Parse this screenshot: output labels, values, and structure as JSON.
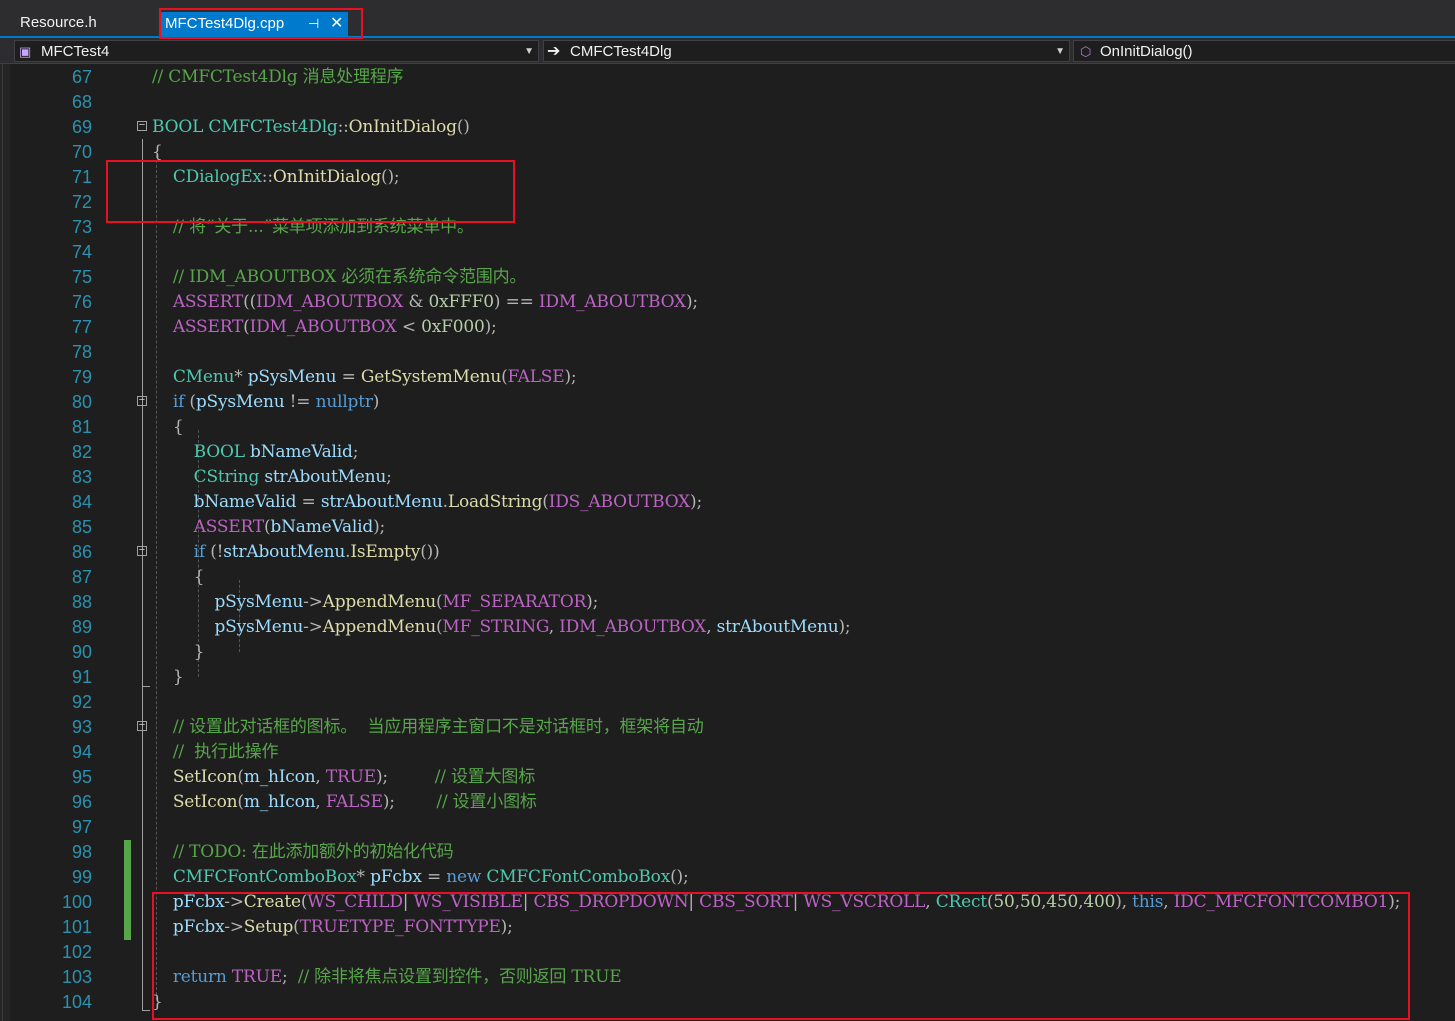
{
  "tabs": {
    "inactive": "Resource.h",
    "active": "MFCTest4Dlg.cpp",
    "pin_glyph": "⊣",
    "close_glyph": "✕"
  },
  "nav": {
    "project": "MFCTest4",
    "class": "CMFCTest4Dlg",
    "member": "OnInitDialog()"
  },
  "colors": {
    "keyword": "#569cd6",
    "type": "#4ec9b0",
    "function": "#dcdcaa",
    "macro": "#bd63c5",
    "comment": "#57a64a",
    "line_number": "#2b91af",
    "annotation_box": "#e81123",
    "active_tab": "#007acc"
  },
  "code_lines": [
    {
      "n": "67",
      "parts": [
        [
          "cm",
          "// CMFCTest4Dlg 消息处理程序"
        ]
      ]
    },
    {
      "n": "68",
      "parts": []
    },
    {
      "n": "69",
      "parts": [
        [
          "ty",
          "BOOL"
        ],
        [
          "pl",
          " "
        ],
        [
          "ty",
          "CMFCTest4Dlg"
        ],
        [
          "pu",
          "::"
        ],
        [
          "fn",
          "OnInitDialog"
        ],
        [
          "pu",
          "()"
        ]
      ]
    },
    {
      "n": "70",
      "parts": [
        [
          "pu",
          "{"
        ]
      ]
    },
    {
      "n": "71",
      "parts": [
        [
          "pl",
          "    "
        ],
        [
          "ty",
          "CDialogEx"
        ],
        [
          "pu",
          "::"
        ],
        [
          "fn",
          "OnInitDialog"
        ],
        [
          "pu",
          "();"
        ]
      ]
    },
    {
      "n": "72",
      "parts": []
    },
    {
      "n": "73",
      "parts": [
        [
          "pl",
          "    "
        ],
        [
          "cm",
          "// 将“关于...”菜单项添加到系统菜单中。"
        ]
      ]
    },
    {
      "n": "74",
      "parts": []
    },
    {
      "n": "75",
      "parts": [
        [
          "pl",
          "    "
        ],
        [
          "cm",
          "// IDM_ABOUTBOX 必须在系统命令范围内。"
        ]
      ]
    },
    {
      "n": "76",
      "parts": [
        [
          "pl",
          "    "
        ],
        [
          "mc",
          "ASSERT"
        ],
        [
          "pu",
          "(("
        ],
        [
          "mc",
          "IDM_ABOUTBOX"
        ],
        [
          "pl",
          " "
        ],
        [
          "pu",
          "&"
        ],
        [
          "pl",
          " "
        ],
        [
          "nu",
          "0xFFF0"
        ],
        [
          "pu",
          ")"
        ],
        [
          "pl",
          " "
        ],
        [
          "pu",
          "=="
        ],
        [
          "pl",
          " "
        ],
        [
          "mc",
          "IDM_ABOUTBOX"
        ],
        [
          "pu",
          ");"
        ]
      ]
    },
    {
      "n": "77",
      "parts": [
        [
          "pl",
          "    "
        ],
        [
          "mc",
          "ASSERT"
        ],
        [
          "pu",
          "("
        ],
        [
          "mc",
          "IDM_ABOUTBOX"
        ],
        [
          "pl",
          " "
        ],
        [
          "pu",
          "<"
        ],
        [
          "pl",
          " "
        ],
        [
          "nu",
          "0xF000"
        ],
        [
          "pu",
          ");"
        ]
      ]
    },
    {
      "n": "78",
      "parts": []
    },
    {
      "n": "79",
      "parts": [
        [
          "pl",
          "    "
        ],
        [
          "ty",
          "CMenu"
        ],
        [
          "pu",
          "*"
        ],
        [
          "pl",
          " "
        ],
        [
          "va",
          "pSysMenu"
        ],
        [
          "pl",
          " "
        ],
        [
          "pu",
          "="
        ],
        [
          "pl",
          " "
        ],
        [
          "fn",
          "GetSystemMenu"
        ],
        [
          "pu",
          "("
        ],
        [
          "mc",
          "FALSE"
        ],
        [
          "pu",
          ");"
        ]
      ]
    },
    {
      "n": "80",
      "parts": [
        [
          "pl",
          "    "
        ],
        [
          "kw",
          "if"
        ],
        [
          "pl",
          " "
        ],
        [
          "pu",
          "("
        ],
        [
          "va",
          "pSysMenu"
        ],
        [
          "pl",
          " "
        ],
        [
          "pu",
          "!="
        ],
        [
          "pl",
          " "
        ],
        [
          "kw",
          "nullptr"
        ],
        [
          "pu",
          ")"
        ]
      ]
    },
    {
      "n": "81",
      "parts": [
        [
          "pl",
          "    "
        ],
        [
          "pu",
          "{"
        ]
      ]
    },
    {
      "n": "82",
      "parts": [
        [
          "pl",
          "        "
        ],
        [
          "ty",
          "BOOL"
        ],
        [
          "pl",
          " "
        ],
        [
          "va",
          "bNameValid"
        ],
        [
          "pu",
          ";"
        ]
      ]
    },
    {
      "n": "83",
      "parts": [
        [
          "pl",
          "        "
        ],
        [
          "ty",
          "CString"
        ],
        [
          "pl",
          " "
        ],
        [
          "va",
          "strAboutMenu"
        ],
        [
          "pu",
          ";"
        ]
      ]
    },
    {
      "n": "84",
      "parts": [
        [
          "pl",
          "        "
        ],
        [
          "va",
          "bNameValid"
        ],
        [
          "pl",
          " "
        ],
        [
          "pu",
          "="
        ],
        [
          "pl",
          " "
        ],
        [
          "va",
          "strAboutMenu"
        ],
        [
          "pu",
          "."
        ],
        [
          "fn",
          "LoadString"
        ],
        [
          "pu",
          "("
        ],
        [
          "mc",
          "IDS_ABOUTBOX"
        ],
        [
          "pu",
          ");"
        ]
      ]
    },
    {
      "n": "85",
      "parts": [
        [
          "pl",
          "        "
        ],
        [
          "mc",
          "ASSERT"
        ],
        [
          "pu",
          "("
        ],
        [
          "va",
          "bNameValid"
        ],
        [
          "pu",
          ");"
        ]
      ]
    },
    {
      "n": "86",
      "parts": [
        [
          "pl",
          "        "
        ],
        [
          "kw",
          "if"
        ],
        [
          "pl",
          " "
        ],
        [
          "pu",
          "(!"
        ],
        [
          "va",
          "strAboutMenu"
        ],
        [
          "pu",
          "."
        ],
        [
          "fn",
          "IsEmpty"
        ],
        [
          "pu",
          "())"
        ]
      ]
    },
    {
      "n": "87",
      "parts": [
        [
          "pl",
          "        "
        ],
        [
          "pu",
          "{"
        ]
      ]
    },
    {
      "n": "88",
      "parts": [
        [
          "pl",
          "            "
        ],
        [
          "va",
          "pSysMenu"
        ],
        [
          "pu",
          "->"
        ],
        [
          "fn",
          "AppendMenu"
        ],
        [
          "pu",
          "("
        ],
        [
          "mc",
          "MF_SEPARATOR"
        ],
        [
          "pu",
          ");"
        ]
      ]
    },
    {
      "n": "89",
      "parts": [
        [
          "pl",
          "            "
        ],
        [
          "va",
          "pSysMenu"
        ],
        [
          "pu",
          "->"
        ],
        [
          "fn",
          "AppendMenu"
        ],
        [
          "pu",
          "("
        ],
        [
          "mc",
          "MF_STRING"
        ],
        [
          "pu",
          ","
        ],
        [
          "pl",
          " "
        ],
        [
          "mc",
          "IDM_ABOUTBOX"
        ],
        [
          "pu",
          ","
        ],
        [
          "pl",
          " "
        ],
        [
          "va",
          "strAboutMenu"
        ],
        [
          "pu",
          ");"
        ]
      ]
    },
    {
      "n": "90",
      "parts": [
        [
          "pl",
          "        "
        ],
        [
          "pu",
          "}"
        ]
      ]
    },
    {
      "n": "91",
      "parts": [
        [
          "pl",
          "    "
        ],
        [
          "pu",
          "}"
        ]
      ]
    },
    {
      "n": "92",
      "parts": []
    },
    {
      "n": "93",
      "parts": [
        [
          "pl",
          "    "
        ],
        [
          "cm",
          "// 设置此对话框的图标。  当应用程序主窗口不是对话框时，框架将自动"
        ]
      ]
    },
    {
      "n": "94",
      "parts": [
        [
          "pl",
          "    "
        ],
        [
          "cm",
          "//  执行此操作"
        ]
      ]
    },
    {
      "n": "95",
      "parts": [
        [
          "pl",
          "    "
        ],
        [
          "fn",
          "SetIcon"
        ],
        [
          "pu",
          "("
        ],
        [
          "va",
          "m_hIcon"
        ],
        [
          "pu",
          ","
        ],
        [
          "pl",
          " "
        ],
        [
          "mc",
          "TRUE"
        ],
        [
          "pu",
          ");"
        ],
        [
          "pl",
          "         "
        ],
        [
          "cm",
          "// 设置大图标"
        ]
      ]
    },
    {
      "n": "96",
      "parts": [
        [
          "pl",
          "    "
        ],
        [
          "fn",
          "SetIcon"
        ],
        [
          "pu",
          "("
        ],
        [
          "va",
          "m_hIcon"
        ],
        [
          "pu",
          ","
        ],
        [
          "pl",
          " "
        ],
        [
          "mc",
          "FALSE"
        ],
        [
          "pu",
          ");"
        ],
        [
          "pl",
          "        "
        ],
        [
          "cm",
          "// 设置小图标"
        ]
      ]
    },
    {
      "n": "97",
      "parts": []
    },
    {
      "n": "98",
      "parts": [
        [
          "pl",
          "    "
        ],
        [
          "cm",
          "// TODO: 在此添加额外的初始化代码"
        ]
      ]
    },
    {
      "n": "99",
      "parts": [
        [
          "pl",
          "    "
        ],
        [
          "ty",
          "CMFCFontComboBox"
        ],
        [
          "pu",
          "*"
        ],
        [
          "pl",
          " "
        ],
        [
          "va",
          "pFcbx"
        ],
        [
          "pl",
          " "
        ],
        [
          "pu",
          "="
        ],
        [
          "pl",
          " "
        ],
        [
          "kw",
          "new"
        ],
        [
          "pl",
          " "
        ],
        [
          "ty",
          "CMFCFontComboBox"
        ],
        [
          "pu",
          "();"
        ]
      ]
    },
    {
      "n": "100",
      "parts": [
        [
          "pl",
          "    "
        ],
        [
          "va",
          "pFcbx"
        ],
        [
          "pu",
          "->"
        ],
        [
          "fn",
          "Create"
        ],
        [
          "pu",
          "("
        ],
        [
          "mc",
          "WS_CHILD"
        ],
        [
          "pu",
          "|"
        ],
        [
          "pl",
          " "
        ],
        [
          "mc",
          "WS_VISIBLE"
        ],
        [
          "pu",
          "|"
        ],
        [
          "pl",
          " "
        ],
        [
          "mc",
          "CBS_DROPDOWN"
        ],
        [
          "pu",
          "|"
        ],
        [
          "pl",
          " "
        ],
        [
          "mc",
          "CBS_SORT"
        ],
        [
          "pu",
          "|"
        ],
        [
          "pl",
          " "
        ],
        [
          "mc",
          "WS_VSCROLL"
        ],
        [
          "pu",
          ","
        ],
        [
          "pl",
          " "
        ],
        [
          "ty",
          "CRect"
        ],
        [
          "pu",
          "("
        ],
        [
          "nu",
          "50"
        ],
        [
          "pu",
          ","
        ],
        [
          "nu",
          "50"
        ],
        [
          "pu",
          ","
        ],
        [
          "nu",
          "450"
        ],
        [
          "pu",
          ","
        ],
        [
          "nu",
          "400"
        ],
        [
          "pu",
          "),"
        ],
        [
          "pl",
          " "
        ],
        [
          "kw",
          "this"
        ],
        [
          "pu",
          ","
        ],
        [
          "pl",
          " "
        ],
        [
          "mc",
          "IDC_MFCFONTCOMBO1"
        ],
        [
          "pu",
          ");"
        ]
      ]
    },
    {
      "n": "101",
      "parts": [
        [
          "pl",
          "    "
        ],
        [
          "va",
          "pFcbx"
        ],
        [
          "pu",
          "->"
        ],
        [
          "fn",
          "Setup"
        ],
        [
          "pu",
          "("
        ],
        [
          "mc",
          "TRUETYPE_FONTTYPE"
        ],
        [
          "pu",
          ");"
        ]
      ]
    },
    {
      "n": "102",
      "parts": []
    },
    {
      "n": "103",
      "parts": [
        [
          "pl",
          "    "
        ],
        [
          "kw",
          "return"
        ],
        [
          "pl",
          " "
        ],
        [
          "mc",
          "TRUE"
        ],
        [
          "pu",
          ";"
        ],
        [
          "pl",
          "  "
        ],
        [
          "cm",
          "// 除非将焦点设置到控件，否则返回 TRUE"
        ]
      ]
    },
    {
      "n": "104",
      "parts": [
        [
          "pu",
          "}"
        ]
      ]
    }
  ],
  "fold_lines": [
    "69",
    "80",
    "86",
    "93"
  ],
  "changed_lines": [
    "98",
    "99",
    "100",
    "101"
  ]
}
